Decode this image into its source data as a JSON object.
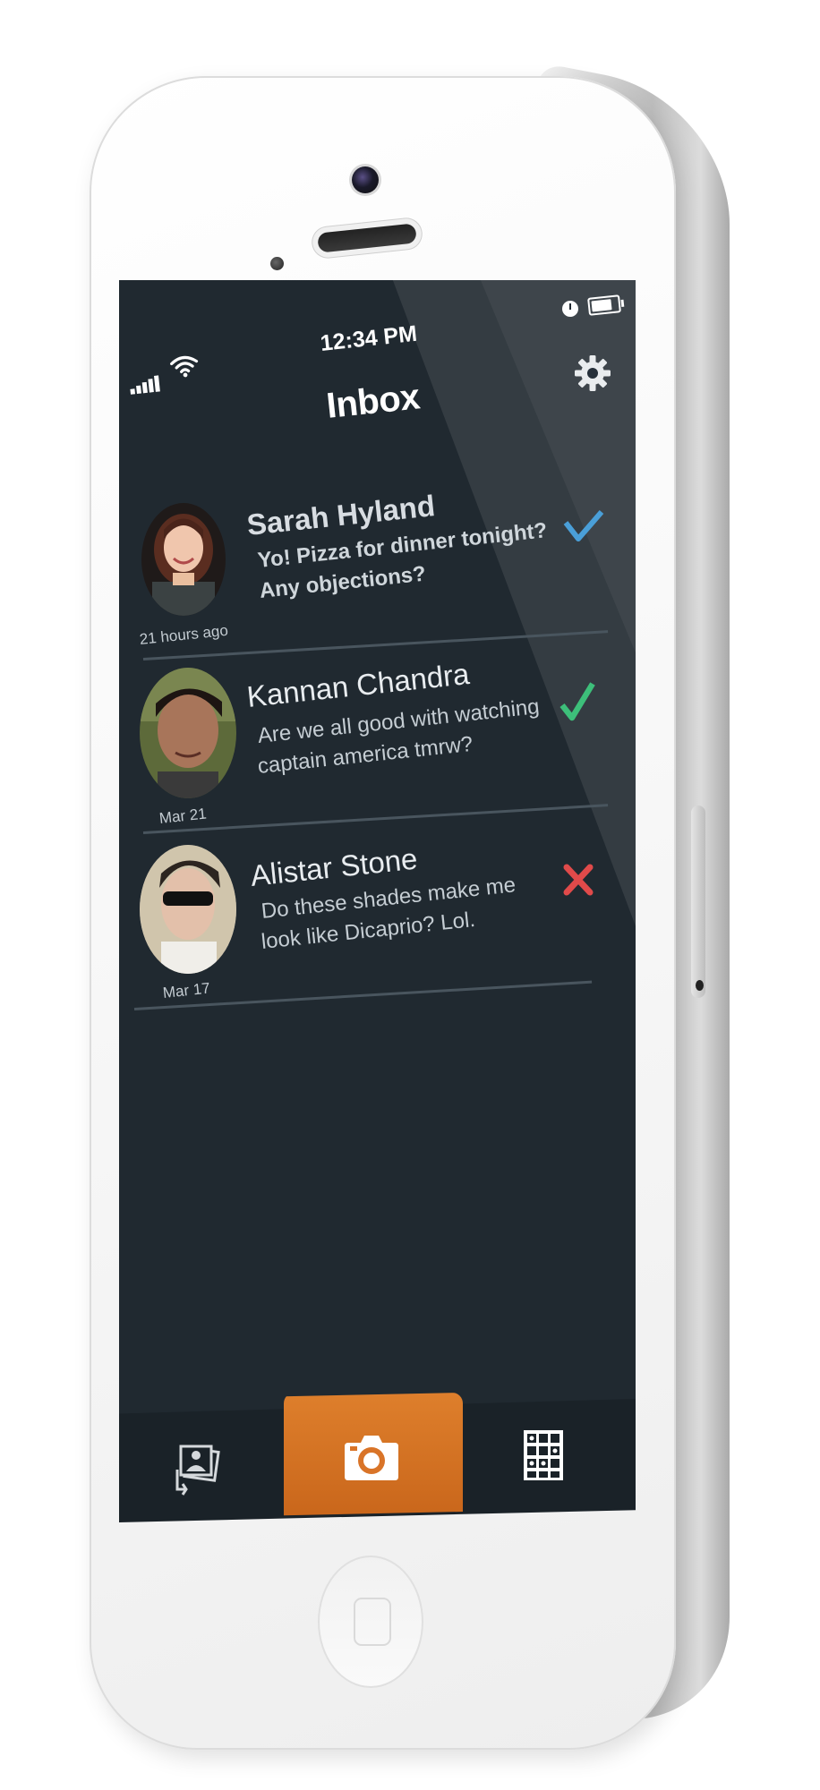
{
  "status_bar": {
    "time": "12:34 PM",
    "signal_icon": "signal-bars-icon",
    "wifi_icon": "wifi-icon",
    "alarm_icon": "clock-icon",
    "battery_icon": "battery-icon"
  },
  "nav": {
    "title": "Inbox",
    "settings_icon": "gear-icon"
  },
  "messages": [
    {
      "name": "Sarah Hyland",
      "line1": "Yo! Pizza for dinner tonight?",
      "line2": "Any objections?",
      "time": "21 hours ago",
      "status": "checkmark-icon",
      "status_color": "#4a9fd8",
      "unread": true
    },
    {
      "name": "Kannan Chandra",
      "line1": "Are we all good with watching",
      "line2": "captain america tmrw?",
      "time": "Mar 21",
      "status": "checkmark-icon",
      "status_color": "#3dbf7a",
      "unread": false
    },
    {
      "name": "Alistar Stone",
      "line1": "Do these shades make me",
      "line2": "look like Dicaprio? Lol.",
      "time": "Mar 17",
      "status": "cross-icon",
      "status_color": "#e04a4a",
      "unread": false
    }
  ],
  "tabbar": {
    "left_icon": "photo-stack-icon",
    "center_icon": "camera-icon",
    "right_icon": "grid-icon",
    "accent_color": "#d97428"
  },
  "colors": {
    "screen_bg": "#202930",
    "divider": "#49555e"
  }
}
